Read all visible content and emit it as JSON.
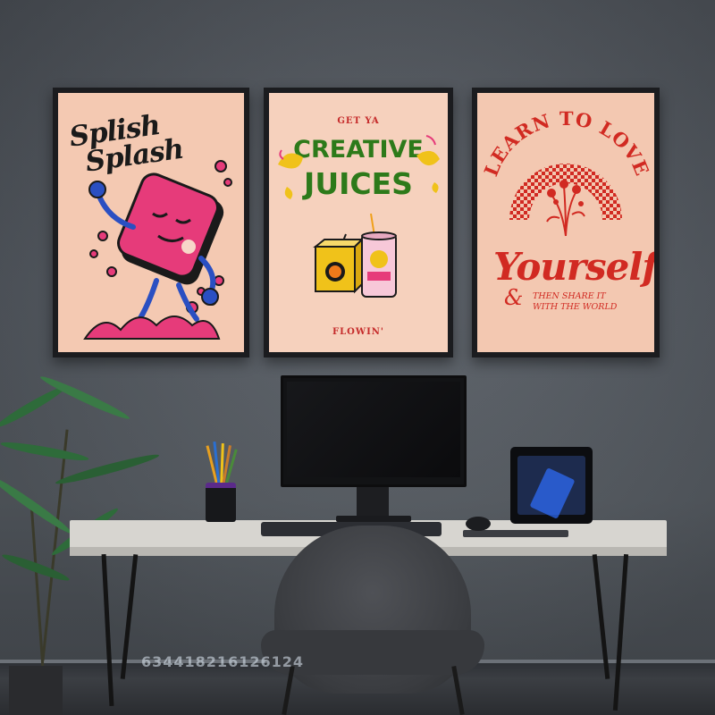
{
  "scene": "home-office",
  "posters": [
    {
      "lines": [
        "Splish",
        "Splash"
      ],
      "colors": {
        "background": "#f4c9b2",
        "accent": "#e63b7a",
        "ink": "#1a1a1a"
      }
    },
    {
      "top": "GET YA",
      "title_1": "CREATIVE",
      "title_2": "JUICES",
      "bottom": "FLOWIN'",
      "colors": {
        "background": "#f6d1bd",
        "accent": "#2d7a1a",
        "highlight": "#f0c21a"
      }
    },
    {
      "arc": "LEARN TO LOVE",
      "main": "Yourself",
      "amp": "&",
      "sub_1": "THEN SHARE IT",
      "sub_2": "WITH THE WORLD",
      "colors": {
        "background": "#f3c8b1",
        "accent": "#d12a22"
      }
    }
  ],
  "watermark": "634418216126124",
  "objects": [
    "monitor",
    "keyboard",
    "mouse",
    "pencil-cup",
    "pc-case",
    "office-chair",
    "desk",
    "potted-palm"
  ]
}
